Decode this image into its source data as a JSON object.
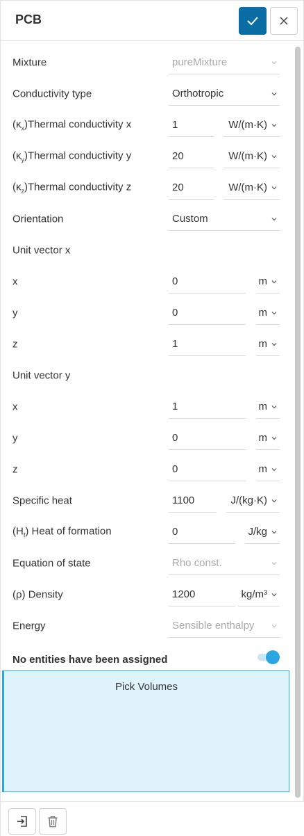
{
  "header": {
    "title": "PCB",
    "confirm_icon": "check-icon",
    "close_icon": "close-icon"
  },
  "colors": {
    "accent": "#0a6ea5",
    "highlight": "#2aa7e3",
    "pick_bg": "#dff3fb"
  },
  "fields": {
    "mixture": {
      "label": "Mixture",
      "value": "pureMixture"
    },
    "conductivity_type": {
      "label": "Conductivity type",
      "value": "Orthotropic"
    },
    "kx": {
      "label_prefix": "(κ",
      "label_sub": "x",
      "label_suffix": ")Thermal conductivity x",
      "value": "1",
      "unit": "W/(m·K)"
    },
    "ky": {
      "label_prefix": "(κ",
      "label_sub": "y",
      "label_suffix": ")Thermal conductivity y",
      "value": "20",
      "unit": "W/(m·K)"
    },
    "kz": {
      "label_prefix": "(κ",
      "label_sub": "z",
      "label_suffix": ")Thermal conductivity z",
      "value": "20",
      "unit": "W/(m·K)"
    },
    "orientation": {
      "label": "Orientation",
      "value": "Custom"
    },
    "unit_vector_x": {
      "heading": "Unit vector x",
      "x": {
        "label": "x",
        "value": "0",
        "unit": "m"
      },
      "y": {
        "label": "y",
        "value": "0",
        "unit": "m"
      },
      "z": {
        "label": "z",
        "value": "1",
        "unit": "m"
      }
    },
    "unit_vector_y": {
      "heading": "Unit vector y",
      "x": {
        "label": "x",
        "value": "1",
        "unit": "m"
      },
      "y": {
        "label": "y",
        "value": "0",
        "unit": "m"
      },
      "z": {
        "label": "z",
        "value": "0",
        "unit": "m"
      }
    },
    "specific_heat": {
      "label": "Specific heat",
      "value": "1100",
      "unit": "J/(kg·K)"
    },
    "heat_of_formation": {
      "label_prefix": "(H",
      "label_sub": "f",
      "label_suffix": ") Heat of formation",
      "value": "0",
      "unit": "J/kg"
    },
    "equation_of_state": {
      "label": "Equation of state",
      "value": "Rho const."
    },
    "density": {
      "label": "(ρ) Density",
      "value": "1200",
      "unit": "kg/m³"
    },
    "energy": {
      "label": "Energy",
      "value": "Sensible enthalpy"
    }
  },
  "assignment": {
    "label": "No entities have been assigned",
    "toggle_on": true,
    "pick_label": "Pick Volumes"
  },
  "footer": {
    "import_icon": "import-icon",
    "delete_icon": "trash-icon"
  }
}
